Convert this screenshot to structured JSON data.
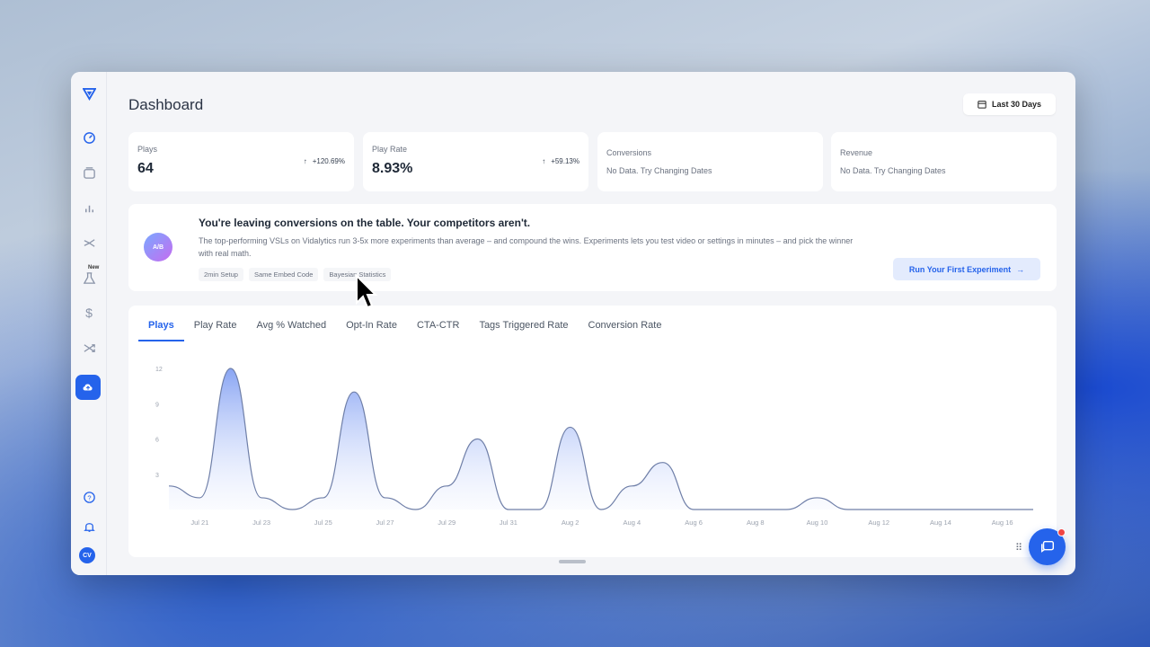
{
  "header": {
    "title": "Dashboard",
    "date_range": "Last 30 Days"
  },
  "sidebar": {
    "items": [
      {
        "icon": "logo-icon"
      },
      {
        "icon": "dashboard-icon"
      },
      {
        "icon": "videos-icon"
      },
      {
        "icon": "analytics-icon"
      },
      {
        "icon": "split-icon"
      },
      {
        "icon": "experiments-icon",
        "badge": "New"
      },
      {
        "icon": "dollar-icon"
      },
      {
        "icon": "shuffle-icon"
      },
      {
        "icon": "upload-icon"
      },
      {
        "icon": "help-icon"
      },
      {
        "icon": "bell-icon"
      }
    ],
    "avatar_initials": "CV"
  },
  "stats": [
    {
      "label": "Plays",
      "value": "64",
      "delta": "+120.69%"
    },
    {
      "label": "Play Rate",
      "value": "8.93%",
      "delta": "+59.13%"
    },
    {
      "label": "Conversions",
      "value": "No Data. Try Changing Dates"
    },
    {
      "label": "Revenue",
      "value": "No Data. Try Changing Dates"
    }
  ],
  "promo": {
    "badge": "A/B",
    "title": "You're leaving conversions on the table. Your competitors aren't.",
    "text": "The top-performing VSLs on Vidalytics run 3-5x more experiments than average – and compound the wins. Experiments lets you test video or settings in minutes – and pick the winner with real math.",
    "chips": [
      "2min Setup",
      "Same Embed Code",
      "Bayesian Statistics"
    ],
    "cta": "Run Your First Experiment"
  },
  "tabs": [
    "Plays",
    "Play Rate",
    "Avg % Watched",
    "Opt-In Rate",
    "CTA-CTR",
    "Tags Triggered Rate",
    "Conversion Rate"
  ],
  "active_tab": "Plays",
  "colors": {
    "accent": "#2563eb",
    "series": "#8aa3f0"
  },
  "chart_data": {
    "type": "area",
    "x": [
      "Jul 20",
      "Jul 21",
      "Jul 22",
      "Jul 23",
      "Jul 24",
      "Jul 25",
      "Jul 26",
      "Jul 27",
      "Jul 28",
      "Jul 29",
      "Jul 30",
      "Jul 31",
      "Aug 1",
      "Aug 2",
      "Aug 3",
      "Aug 4",
      "Aug 5",
      "Aug 6",
      "Aug 7",
      "Aug 8",
      "Aug 9",
      "Aug 10",
      "Aug 11",
      "Aug 12",
      "Aug 13",
      "Aug 14",
      "Aug 15",
      "Aug 16",
      "Aug 17"
    ],
    "series": [
      {
        "values": [
          2,
          1,
          12,
          1,
          0,
          1,
          10,
          1,
          0,
          2,
          6,
          0,
          0,
          7,
          0,
          2,
          4,
          0,
          0,
          0,
          0,
          1,
          0,
          0,
          0,
          0,
          0,
          0,
          0
        ]
      }
    ],
    "tick_labels": [
      "Jul 21",
      "Jul 23",
      "Jul 25",
      "Jul 27",
      "Jul 29",
      "Jul 31",
      "Aug 2",
      "Aug 4",
      "Aug 6",
      "Aug 8",
      "Aug 10",
      "Aug 12",
      "Aug 14",
      "Aug 16"
    ],
    "yticks": [
      3,
      6,
      9,
      12
    ],
    "ylim": [
      0,
      12
    ],
    "grid": false
  }
}
